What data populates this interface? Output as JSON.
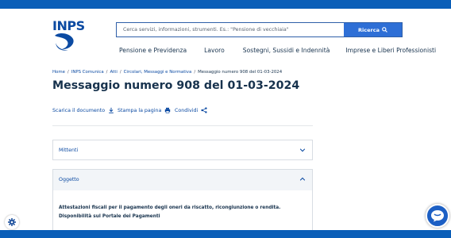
{
  "logo": {
    "text": "INPS"
  },
  "search": {
    "placeholder": "Cerca servizi, informazioni, strumenti. Es.: \"Pensione di vecchiaia\"",
    "button_label": "Ricerca"
  },
  "nav": {
    "items": [
      {
        "label": "Pensione e Previdenza"
      },
      {
        "label": "Lavoro"
      },
      {
        "label": "Sostegni, Sussidi e Indennità"
      },
      {
        "label": "Imprese e Liberi Professionisti"
      }
    ]
  },
  "breadcrumb": {
    "items": [
      {
        "label": "Home"
      },
      {
        "label": "INPS Comunica"
      },
      {
        "label": "Atti"
      },
      {
        "label": "Circolari, Messaggi e Normativa"
      },
      {
        "label": "Messaggio numero 908 del 01-03-2024"
      }
    ]
  },
  "page": {
    "title": "Messaggio numero 908 del 01-03-2024"
  },
  "actions": {
    "download": "Scarica il documento",
    "print": "Stampa la pagina",
    "share": "Condividi"
  },
  "accordion": {
    "mittenti": {
      "label": "Mittenti"
    },
    "oggetto": {
      "label": "Oggetto",
      "body": "Attestazioni fiscali per il pagamento degli oneri da riscatto, ricongiunzione o rendita. Disponibilità sul Portale dei Pagamenti"
    }
  },
  "colors": {
    "brand": "#0a5eb8",
    "link": "#0b4aa2",
    "text": "#17324d",
    "button": "#2e6fd6"
  },
  "icons": {
    "search": "search-icon",
    "download": "download-icon",
    "print": "print-icon",
    "share": "share-icon",
    "chevron_down": "chevron-down-icon",
    "chevron_up": "chevron-up-icon",
    "cookie_settings": "gear-icon",
    "chat": "chat-icon"
  }
}
